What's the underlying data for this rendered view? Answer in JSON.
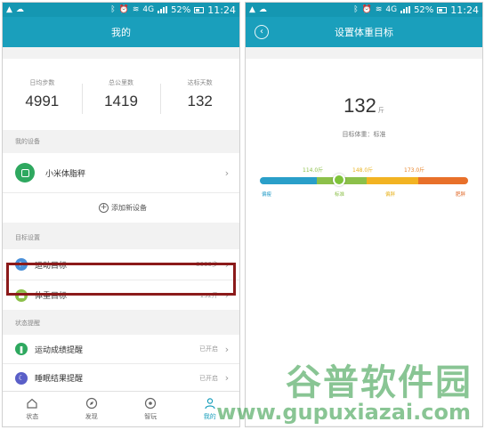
{
  "status_bar": {
    "battery_percent": "52%",
    "time": "11:24",
    "network": "4G"
  },
  "left_screen": {
    "title": "我的",
    "stats": [
      {
        "label": "日均步数",
        "value": "4991"
      },
      {
        "label": "总公里数",
        "value": "1419"
      },
      {
        "label": "达标天数",
        "value": "132"
      }
    ],
    "devices_section": "我的设备",
    "device_name": "小米体脂秤",
    "add_device_label": "添加新设备",
    "goals_section": "目标设置",
    "goals": [
      {
        "label": "运动目标",
        "value": "8000步",
        "icon": "run-goal-icon",
        "color": "#4a90d9"
      },
      {
        "label": "体重目标",
        "value": "132斤",
        "icon": "weight-goal-icon",
        "color": "#8cc04a"
      }
    ],
    "reminders_section": "状态提醒",
    "reminders": [
      {
        "label": "运动成绩提醒",
        "value": "已开启",
        "icon": "footprint-icon",
        "color": "#2ea85f"
      },
      {
        "label": "睡眠结果提醒",
        "value": "已开启",
        "icon": "moon-icon",
        "color": "#5a5fc8"
      }
    ],
    "tabs": [
      {
        "label": "状态",
        "icon": "home-icon"
      },
      {
        "label": "发现",
        "icon": "compass-icon"
      },
      {
        "label": "智玩",
        "icon": "target-icon"
      },
      {
        "label": "我的",
        "icon": "person-icon"
      }
    ],
    "active_tab": "我的"
  },
  "right_screen": {
    "title": "设置体重目标",
    "weight_value": "132",
    "weight_unit": "斤",
    "weight_status": "目标体重：标准",
    "thresholds": [
      {
        "label": "114.0斤",
        "color": "#8cc04a"
      },
      {
        "label": "148.0斤",
        "color": "#e8b320"
      },
      {
        "label": "173.0斤",
        "color": "#e8842a"
      }
    ],
    "levels": [
      {
        "label": "偏瘦",
        "color": "#2a9fc9"
      },
      {
        "label": "标准",
        "color": "#8cc04a"
      },
      {
        "label": "偏胖",
        "color": "#e8b320"
      },
      {
        "label": "肥胖",
        "color": "#e06a2a"
      }
    ],
    "segment_colors": [
      "#2a9fc9",
      "#8cc04a",
      "#f2b322",
      "#e8702a"
    ],
    "knob_fraction": 0.38
  },
  "watermark": {
    "brand_cn": "谷普软件园",
    "url": "www.gupuxiazai.com"
  },
  "colors": {
    "header": "#1a9fbc",
    "status_bar": "#1597b2",
    "highlight_box": "#8b1a1a",
    "accent": "#1a9fbc"
  }
}
